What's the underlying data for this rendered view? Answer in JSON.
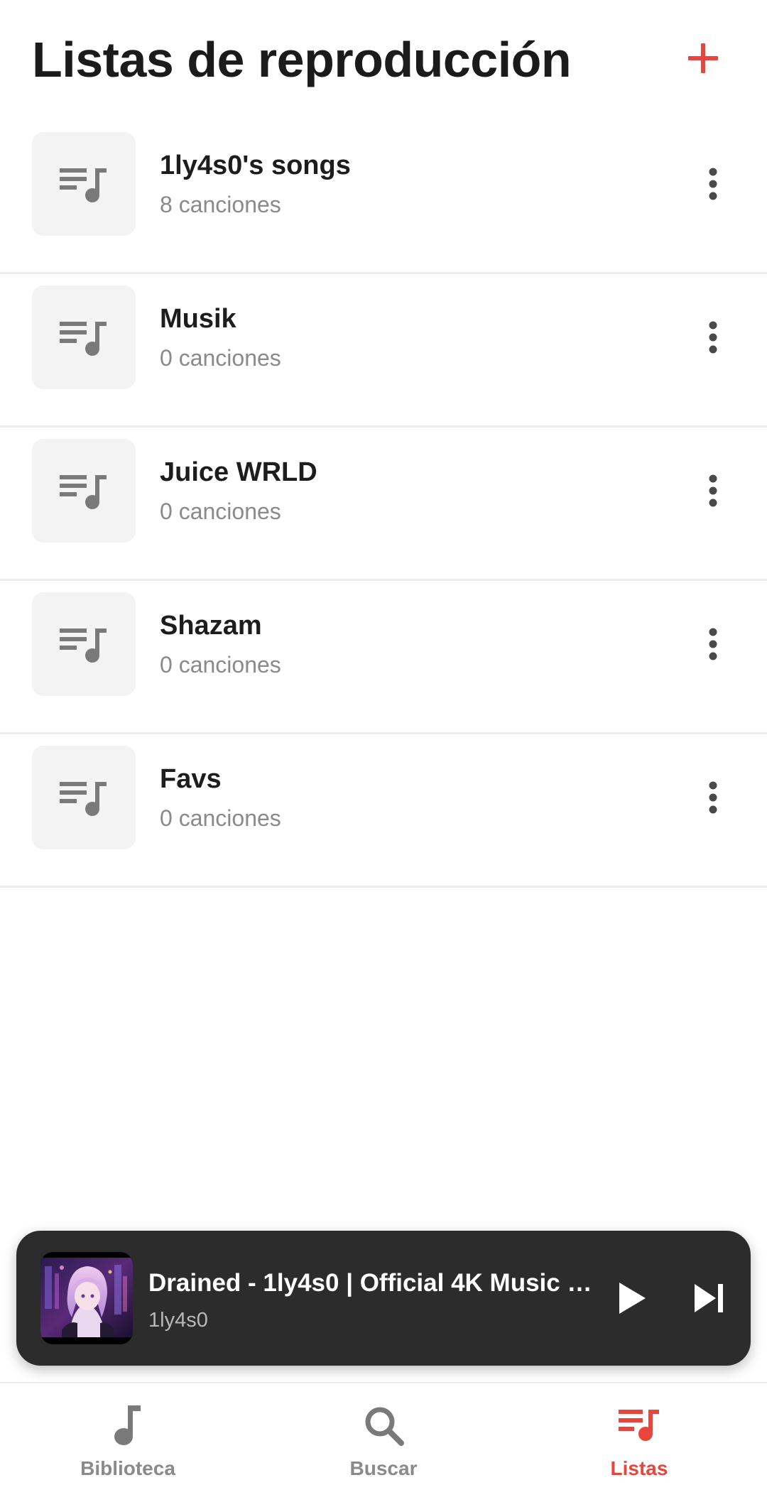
{
  "header": {
    "title": "Listas de reproducción",
    "add_icon": "plus-icon"
  },
  "playlists": [
    {
      "name": "1ly4s0's songs",
      "count": "8 canciones"
    },
    {
      "name": "Musik",
      "count": "0 canciones"
    },
    {
      "name": "Juice WRLD",
      "count": "0 canciones"
    },
    {
      "name": "Shazam",
      "count": "0 canciones"
    },
    {
      "name": "Favs",
      "count": "0 canciones"
    }
  ],
  "player": {
    "title": "Drained - 1ly4s0 | Official 4K Music Video",
    "artist": "1ly4s0",
    "play_icon": "play-icon",
    "next_icon": "skip-next-icon"
  },
  "nav": {
    "items": [
      {
        "label": "Biblioteca",
        "icon": "music-note-icon"
      },
      {
        "label": "Buscar",
        "icon": "search-icon"
      },
      {
        "label": "Listas",
        "icon": "playlist-icon"
      }
    ],
    "active": "Listas"
  },
  "colors": {
    "accent": "#e8453c",
    "icon_gray": "#7a7a7a",
    "thumb_bg": "#f3f3f3",
    "player_bg": "#2c2c2c"
  }
}
